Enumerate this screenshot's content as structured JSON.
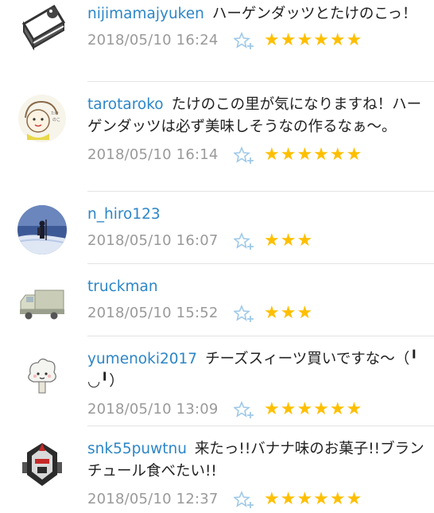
{
  "comments": [
    {
      "user": "nijimamajyuken",
      "text": "ハーゲンダッツとたけのこっ！",
      "time": "2018/05/10 16:24",
      "stars": "★★★★★★",
      "avatar_icon": "cake-slice-icon"
    },
    {
      "user": "tarotaroko",
      "text": "たけのこの里が気になりますね！ハーゲンダッツは必ず美味しそうなの作るなぁ〜。",
      "time": "2018/05/10 16:14",
      "stars": "★★★★★★",
      "avatar_icon": "hand-drawn-face-icon"
    },
    {
      "user": "n_hiro123",
      "text": "",
      "time": "2018/05/10 16:07",
      "stars": "★★★",
      "avatar_icon": "mountain-photo-icon"
    },
    {
      "user": "truckman",
      "text": "",
      "time": "2018/05/10 15:52",
      "stars": "★★★",
      "avatar_icon": "truck-icon"
    },
    {
      "user": "yumenoki2017",
      "text": "チーズスィーツ買いですな〜（╹◡╹）",
      "time": "2018/05/10 13:09",
      "stars": "★★★★★★",
      "avatar_icon": "tree-character-icon"
    },
    {
      "user": "snk55puwtnu",
      "text": "来たっ!!バナナ味のお菓子!!ブランチュール食べたい!!",
      "time": "2018/05/10 12:37",
      "stars": "★★★★★★",
      "avatar_icon": "robot-icon"
    }
  ],
  "colors": {
    "username": "#2c86c7",
    "star": "#ffbf00",
    "timestamp": "#9a9a9a",
    "star_button": "#9ec9ea"
  }
}
